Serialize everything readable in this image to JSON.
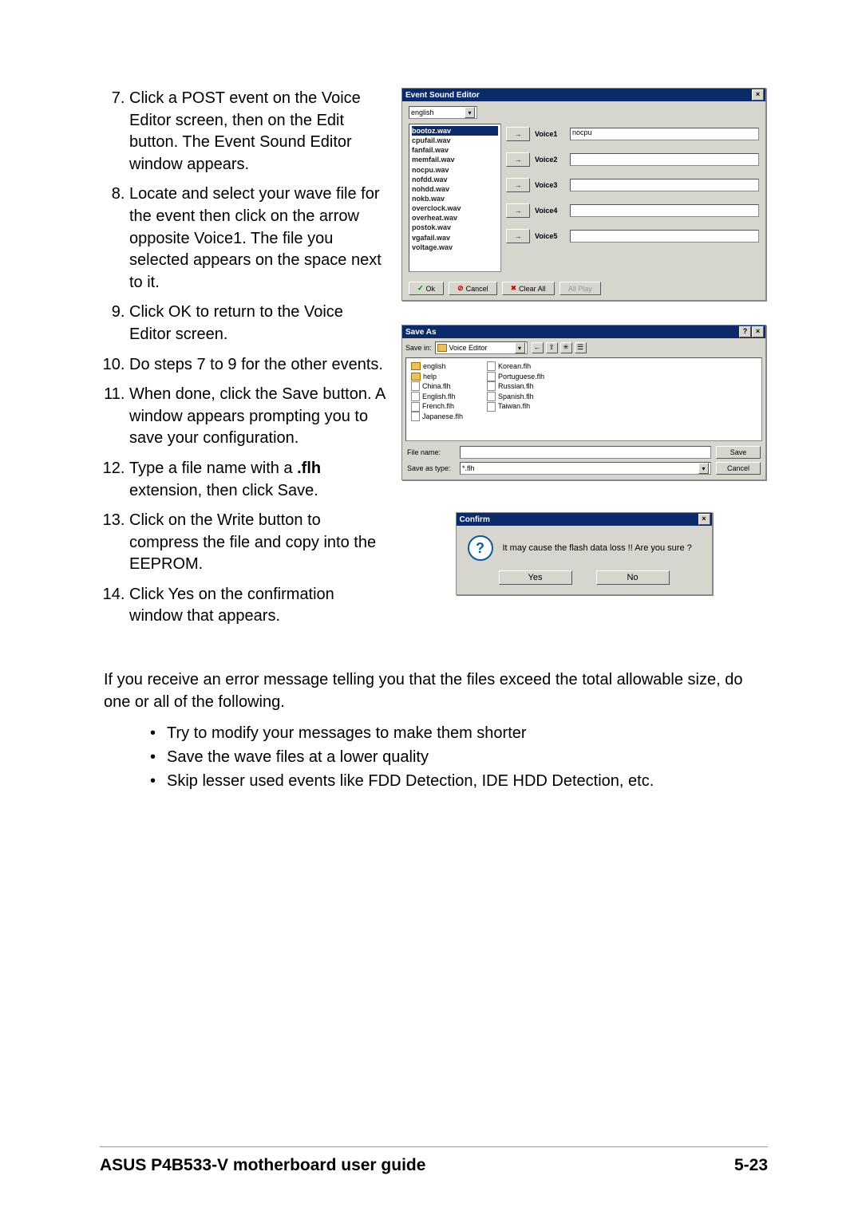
{
  "steps": {
    "s7": "Click a POST event on the Voice Editor screen, then on the Edit button. The Event Sound Editor window appears.",
    "s8": "Locate and select your wave file for the event then click on the arrow opposite Voice1. The file you selected appears on the space next to it.",
    "s9": "Click OK to return to the Voice Editor screen.",
    "s10": "Do steps 7 to 9 for the other events.",
    "s11": "When done, click the Save button. A window appears prompting you to  save your configuration.",
    "s12a": "Type a file name with a ",
    "s12b": ".flh",
    "s12c": " extension, then click Save.",
    "s13": "Click on the Write button to compress the file and copy into the EEPROM.",
    "s14": "Click Yes on the confirmation window that appears."
  },
  "ese": {
    "title": "Event Sound Editor",
    "dropdown": "english",
    "files": [
      "bootoz.wav",
      "cpufail.wav",
      "fanfail.wav",
      "memfail.wav",
      "nocpu.wav",
      "nofdd.wav",
      "nohdd.wav",
      "nokb.wav",
      "overclock.wav",
      "overheat.wav",
      "postok.wav",
      "vgafail.wav",
      "voltage.wav"
    ],
    "voices": [
      {
        "label": "Voice1",
        "value": "nocpu"
      },
      {
        "label": "Voice2",
        "value": ""
      },
      {
        "label": "Voice3",
        "value": ""
      },
      {
        "label": "Voice4",
        "value": ""
      },
      {
        "label": "Voice5",
        "value": ""
      }
    ],
    "btn_ok": "Ok",
    "btn_cancel": "Cancel",
    "btn_clear": "Clear All",
    "btn_play": "All Play"
  },
  "saveas": {
    "title": "Save As",
    "savein_label": "Save in:",
    "savein_value": "Voice Editor",
    "col1": [
      "english",
      "help",
      "China.flh",
      "English.flh",
      "French.flh",
      "Japanese.flh"
    ],
    "col2": [
      "Korean.flh",
      "Portuguese.flh",
      "Russian.flh",
      "Spanish.flh",
      "Taiwan.flh"
    ],
    "filename_label": "File name:",
    "filename_value": "",
    "savetype_label": "Save as type:",
    "savetype_value": "*.flh",
    "btn_save": "Save",
    "btn_cancel": "Cancel"
  },
  "confirm": {
    "title": "Confirm",
    "msg": "It may cause the flash data loss !!  Are you sure ?",
    "yes": "Yes",
    "no": "No"
  },
  "para": "If you receive an error message telling you that the files exceed the total allowable size, do one or all of the following.",
  "bullets": [
    "Try to modify your messages to make them shorter",
    "Save the wave files at a lower quality",
    "Skip lesser used events like FDD Detection, IDE HDD Detection, etc."
  ],
  "footer_left": "ASUS P4B533-V motherboard user guide",
  "footer_right": "5-23"
}
